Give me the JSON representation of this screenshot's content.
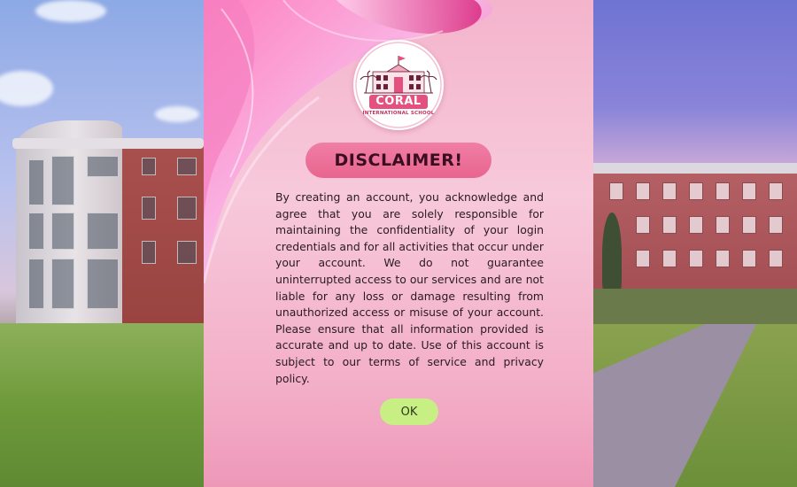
{
  "dialog": {
    "title": "DISCLAIMER!",
    "body": "By creating an account, you acknowledge and agree that you are solely responsible for maintaining the confidentiality of your login credentials and for all activities that occur under your account. We do not guarantee uninterrupted access to our services and are not liable for any loss or damage resulting from unauthorized access or misuse of your account. Please ensure that all information provided is accurate and up to date. Use of this account is subject to our terms of service and privacy policy.",
    "ok_label": "OK"
  },
  "logo": {
    "name": "CORAL",
    "subtitle": "INTERNATIONAL SCHOOL"
  },
  "colors": {
    "card_pink": "#f7c9da",
    "title_pill": "#e8658f",
    "ok_button": "#c7ef84",
    "logo_accent": "#e5517f"
  }
}
